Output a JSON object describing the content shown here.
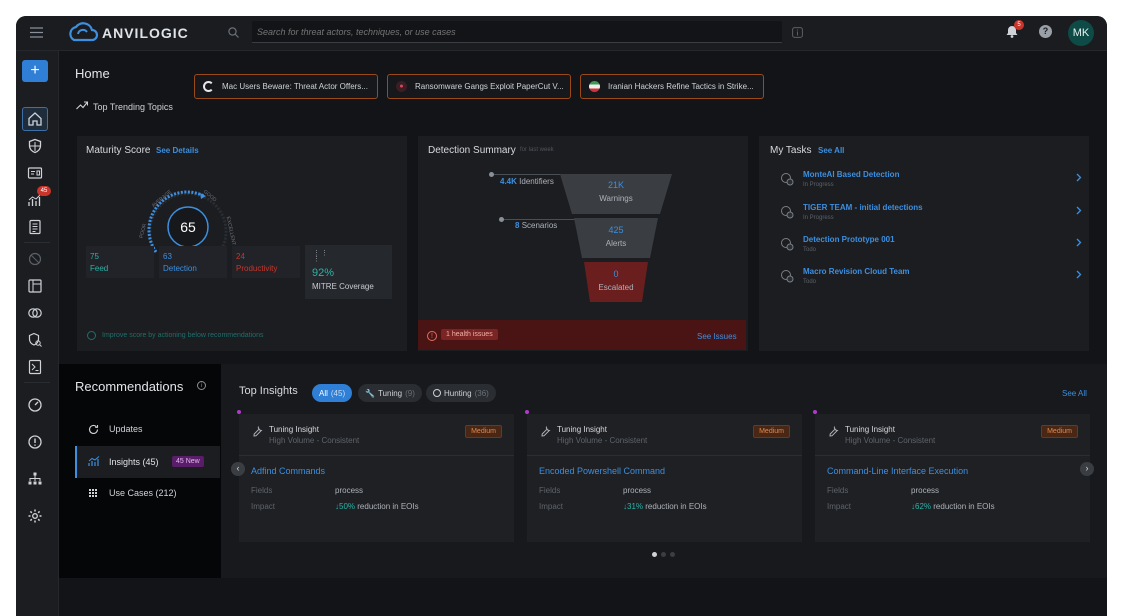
{
  "app": {
    "name": "ANVILOGIC",
    "search_placeholder": "Search for threat actors, techniques, or use cases",
    "notif_count": "5",
    "user_initials": "MK"
  },
  "sidebar": {
    "reports_badge": "45"
  },
  "home": {
    "title": "Home",
    "trending_label": "Top Trending Topics",
    "topics": [
      "Mac Users Beware: Threat Actor Offers...",
      "Ransomware Gangs Exploit PaperCut V...",
      "Iranian Hackers Refine Tactics in Strike..."
    ]
  },
  "maturity": {
    "title": "Maturity Score",
    "link": "See Details",
    "score": "65",
    "arc_labels": [
      "POOR",
      "AVERAGE",
      "GOOD",
      "EXCELLENT"
    ],
    "stats": [
      {
        "value": "75",
        "label": "Feed"
      },
      {
        "value": "63",
        "label": "Detection"
      },
      {
        "value": "24",
        "label": "Productivity"
      }
    ],
    "mitre": {
      "value": "92%",
      "label": "MITRE Coverage"
    },
    "hint": "Improve score by actioning below recommendations"
  },
  "detection": {
    "title": "Detection Summary",
    "subtitle": "for last week",
    "identifiers": {
      "value": "4.4K",
      "label": "Identifiers"
    },
    "scenarios": {
      "value": "8",
      "label": "Scenarios"
    },
    "funnel": [
      {
        "value": "21K",
        "label": "Warnings"
      },
      {
        "value": "425",
        "label": "Alerts"
      },
      {
        "value": "0",
        "label": "Escalated"
      }
    ],
    "health": "1 health issues",
    "health_link": "See Issues"
  },
  "tasks": {
    "title": "My Tasks",
    "link": "See All",
    "items": [
      {
        "name": "MonteAI Based Detection",
        "status": "In Progress"
      },
      {
        "name": "TIGER TEAM - initial detections",
        "status": "In Progress"
      },
      {
        "name": "Detection Prototype 001",
        "status": "Todo"
      },
      {
        "name": "Macro Revision Cloud Team",
        "status": "Todo"
      }
    ]
  },
  "recommendations": {
    "title": "Recommendations",
    "menu": [
      {
        "label": "Updates"
      },
      {
        "label": "Insights (45)",
        "badge": "45 New"
      },
      {
        "label": "Use Cases (212)"
      }
    ]
  },
  "insights": {
    "title": "Top Insights",
    "see_all": "See All",
    "filters": [
      {
        "label": "All",
        "count": "(45)"
      },
      {
        "label": "Tuning",
        "count": "(9)"
      },
      {
        "label": "Hunting",
        "count": "(36)"
      }
    ],
    "cards": [
      {
        "type": "Tuning Insight",
        "sub": "High Volume - Consistent",
        "severity": "Medium",
        "name": "Adfind Commands",
        "fields_label": "Fields",
        "fields": "process",
        "impact_label": "Impact",
        "impact_pct": "50%",
        "impact_text": "reduction in EOIs"
      },
      {
        "type": "Tuning Insight",
        "sub": "High Volume - Consistent",
        "severity": "Medium",
        "name": "Encoded Powershell Command",
        "fields_label": "Fields",
        "fields": "process",
        "impact_label": "Impact",
        "impact_pct": "31%",
        "impact_text": "reduction in EOIs"
      },
      {
        "type": "Tuning Insight",
        "sub": "High Volume - Consistent",
        "severity": "Medium",
        "name": "Command-Line Interface Execution",
        "fields_label": "Fields",
        "fields": "process",
        "impact_label": "Impact",
        "impact_pct": "62%",
        "impact_text": "reduction in EOIs"
      }
    ]
  },
  "colors": {
    "accent": "#3d8fe0",
    "warning": "#e0884a",
    "danger": "#c9352b",
    "teal": "#2bb3a6"
  }
}
